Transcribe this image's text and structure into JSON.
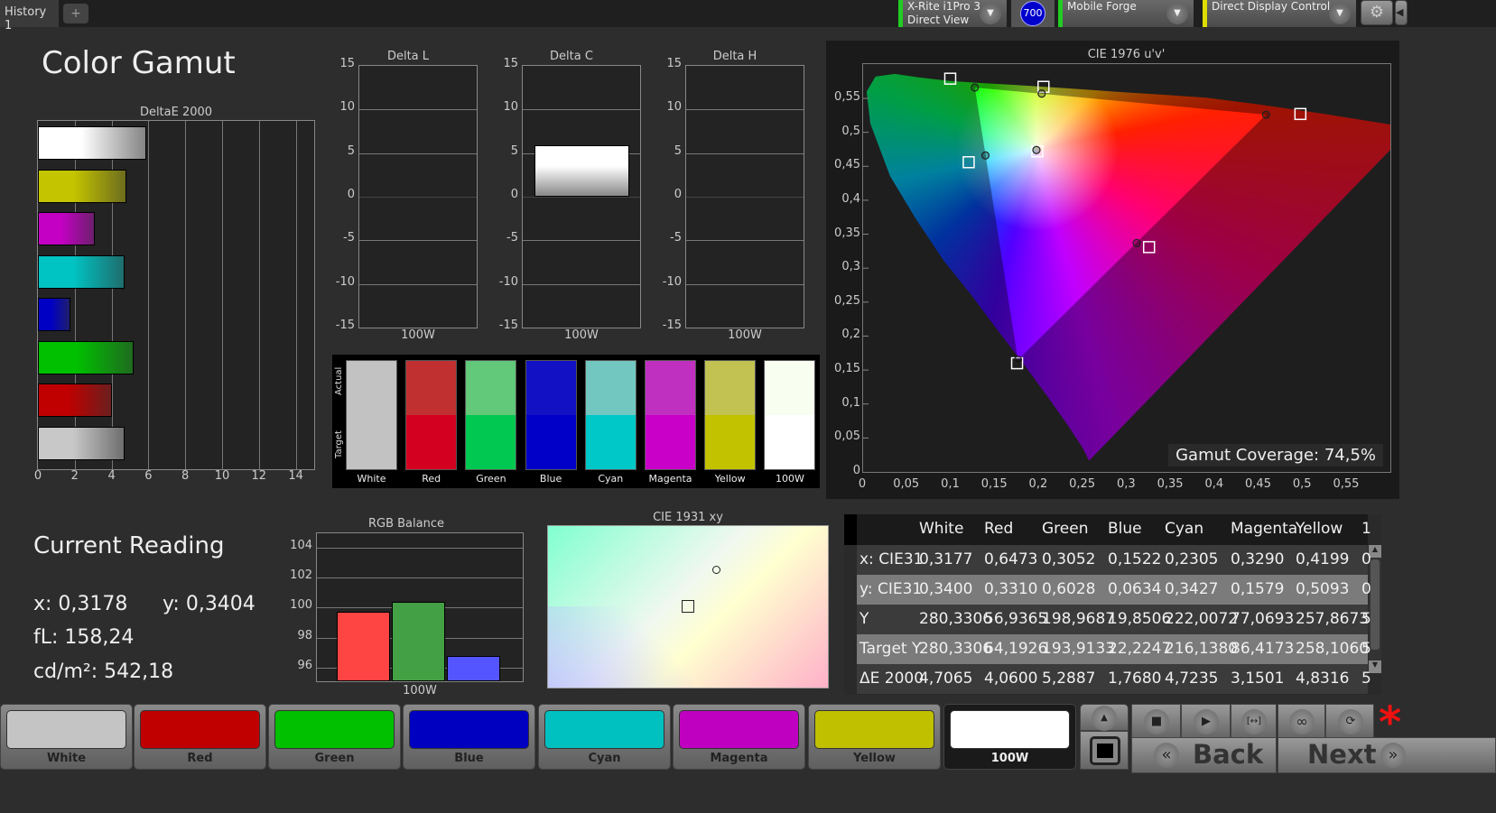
{
  "topbar": {
    "tab": "History 1",
    "tab_add": "+",
    "meter": {
      "line1": "X-Rite i1Pro 3",
      "line2": "Direct View",
      "indicator_color": "#22cc22"
    },
    "meter_badge": "700",
    "source": {
      "line1": "Mobile Forge",
      "indicator_color": "#22cc22"
    },
    "display": {
      "line1": "Direct Display Control",
      "indicator_color": "#dddd00"
    },
    "settings_icon": "gear-icon",
    "collapse_icon": "chevron-left-icon"
  },
  "page_title": "Color Gamut",
  "current_reading": {
    "title": "Current Reading",
    "x": "x: 0,3178",
    "y": "y: 0,3404",
    "fl": "fL: 158,24",
    "cdm2": "cd/m²: 542,18"
  },
  "swatches": {
    "actual_label": "Actual",
    "target_label": "Target",
    "items": [
      {
        "label": "White",
        "actual": "#c2c2c2",
        "target": "#c2c2c2"
      },
      {
        "label": "Red",
        "actual": "#c03030",
        "target": "#d40020"
      },
      {
        "label": "Green",
        "actual": "#62c87a",
        "target": "#00c850"
      },
      {
        "label": "Blue",
        "actual": "#1212c4",
        "target": "#0000c8"
      },
      {
        "label": "Cyan",
        "actual": "#72c8c0",
        "target": "#00c8c8"
      },
      {
        "label": "Magenta",
        "actual": "#c030c0",
        "target": "#c800c8"
      },
      {
        "label": "Yellow",
        "actual": "#c2c252",
        "target": "#c2c200"
      },
      {
        "label": "100W",
        "actual": "#f8fff0",
        "target": "#ffffff"
      }
    ]
  },
  "chart_data": [
    {
      "type": "bar",
      "orientation": "horizontal",
      "title": "DeltaE 2000",
      "categories": [
        "100W",
        "Yellow",
        "Magenta",
        "Cyan",
        "Blue",
        "Green",
        "Red",
        "White"
      ],
      "values": [
        5.9,
        4.8,
        3.1,
        4.7,
        1.77,
        5.2,
        4.0,
        4.7
      ],
      "colors": [
        "#ffffff",
        "#c4c400",
        "#c400c4",
        "#00c4c4",
        "#0000c4",
        "#00c000",
        "#c00000",
        "#c8c8c8"
      ],
      "xlim": [
        0,
        15
      ],
      "xticks": [
        "0",
        "2",
        "4",
        "6",
        "8",
        "10",
        "12",
        "14"
      ]
    },
    {
      "type": "bar",
      "title": "Delta L",
      "categories": [
        "100W"
      ],
      "values": [
        0
      ],
      "ylim": [
        -15,
        15
      ],
      "yticks": [
        "15",
        "10",
        "5",
        "0",
        "-5",
        "-10",
        "-15"
      ]
    },
    {
      "type": "bar",
      "title": "Delta C",
      "categories": [
        "100W"
      ],
      "values": [
        5.9
      ],
      "ylim": [
        -15,
        15
      ],
      "yticks": [
        "15",
        "10",
        "5",
        "0",
        "-5",
        "-10",
        "-15"
      ]
    },
    {
      "type": "bar",
      "title": "Delta H",
      "categories": [
        "100W"
      ],
      "values": [
        0
      ],
      "ylim": [
        -15,
        15
      ],
      "yticks": [
        "15",
        "10",
        "5",
        "0",
        "-5",
        "-10",
        "-15"
      ]
    },
    {
      "type": "scatter",
      "title": "CIE 1976 u'v'",
      "xlim": [
        0,
        0.6
      ],
      "ylim": [
        0,
        0.6
      ],
      "xticks": [
        "0",
        "0,05",
        "0,1",
        "0,15",
        "0,2",
        "0,25",
        "0,3",
        "0,35",
        "0,4",
        "0,45",
        "0,5",
        "0,55"
      ],
      "yticks": [
        "0",
        "0,05",
        "0,1",
        "0,15",
        "0,2",
        "0,25",
        "0,3",
        "0,35",
        "0,4",
        "0,45",
        "0,5",
        "0,55"
      ],
      "targets": [
        {
          "name": "White",
          "u": 0.198,
          "v": 0.472
        },
        {
          "name": "Red",
          "u": 0.497,
          "v": 0.527
        },
        {
          "name": "Green",
          "u": 0.099,
          "v": 0.579
        },
        {
          "name": "Blue",
          "u": 0.175,
          "v": 0.16
        },
        {
          "name": "Cyan",
          "u": 0.12,
          "v": 0.456
        },
        {
          "name": "Magenta",
          "u": 0.325,
          "v": 0.331
        },
        {
          "name": "Yellow",
          "u": 0.205,
          "v": 0.567
        }
      ],
      "measured": [
        {
          "name": "White",
          "u": 0.197,
          "v": 0.474
        },
        {
          "name": "Red",
          "u": 0.458,
          "v": 0.526
        },
        {
          "name": "Green",
          "u": 0.127,
          "v": 0.566
        },
        {
          "name": "Blue",
          "u": 0.176,
          "v": 0.165
        },
        {
          "name": "Cyan",
          "u": 0.139,
          "v": 0.466
        },
        {
          "name": "Magenta",
          "u": 0.311,
          "v": 0.337
        },
        {
          "name": "Yellow",
          "u": 0.203,
          "v": 0.557
        }
      ],
      "annotation": "Gamut Coverage:  74,5%"
    },
    {
      "type": "bar",
      "title": "RGB Balance",
      "categories": [
        "100W"
      ],
      "series": [
        {
          "color": "#ff4444",
          "values": [
            99.7
          ]
        },
        {
          "color": "#44a044",
          "values": [
            100.4
          ]
        },
        {
          "color": "#5555ff",
          "values": [
            96.8
          ]
        }
      ],
      "ylim": [
        95,
        105
      ],
      "yticks": [
        "104",
        "102",
        "100",
        "98",
        "96"
      ]
    },
    {
      "type": "scatter",
      "title": "CIE 1931 xy",
      "target": {
        "x": 0.3127,
        "y": 0.329
      },
      "measured": {
        "x": 0.3178,
        "y": 0.3404
      }
    }
  ],
  "table": {
    "headers": [
      "",
      "White",
      "Red",
      "Green",
      "Blue",
      "Cyan",
      "Magenta",
      "Yellow",
      "1"
    ],
    "rows": [
      [
        "x: CIE31",
        "0,3177",
        "0,6473",
        "0,3052",
        "0,1522",
        "0,2305",
        "0,3290",
        "0,4199",
        "0"
      ],
      [
        "y: CIE31",
        "0,3400",
        "0,3310",
        "0,6028",
        "0,0634",
        "0,3427",
        "0,1579",
        "0,5093",
        "0"
      ],
      [
        "Y",
        "280,3306",
        "56,9365",
        "198,9687",
        "19,8506",
        "222,0072",
        "77,0693",
        "257,8673",
        "5"
      ],
      [
        "Target Y",
        "280,3306",
        "64,1926",
        "193,9133",
        "22,2247",
        "216,1380",
        "86,4173",
        "258,1060",
        "5"
      ],
      [
        "ΔE 2000",
        "4,7065",
        "4,0600",
        "5,2887",
        "1,7680",
        "4,7235",
        "3,1501",
        "4,8316",
        "5"
      ]
    ]
  },
  "patches": [
    {
      "label": "White",
      "color": "#c4c4c4"
    },
    {
      "label": "Red",
      "color": "#c00000"
    },
    {
      "label": "Green",
      "color": "#00c000"
    },
    {
      "label": "Blue",
      "color": "#0000c0"
    },
    {
      "label": "Cyan",
      "color": "#00c0c0"
    },
    {
      "label": "Magenta",
      "color": "#c000c0"
    },
    {
      "label": "Yellow",
      "color": "#c0c000"
    },
    {
      "label": "100W",
      "color": "#ffffff"
    }
  ],
  "controls": {
    "back": "Back",
    "next": "Next",
    "back_icon": "«",
    "next_icon": "»",
    "alert": "*",
    "alert_color": "#ee1111"
  }
}
